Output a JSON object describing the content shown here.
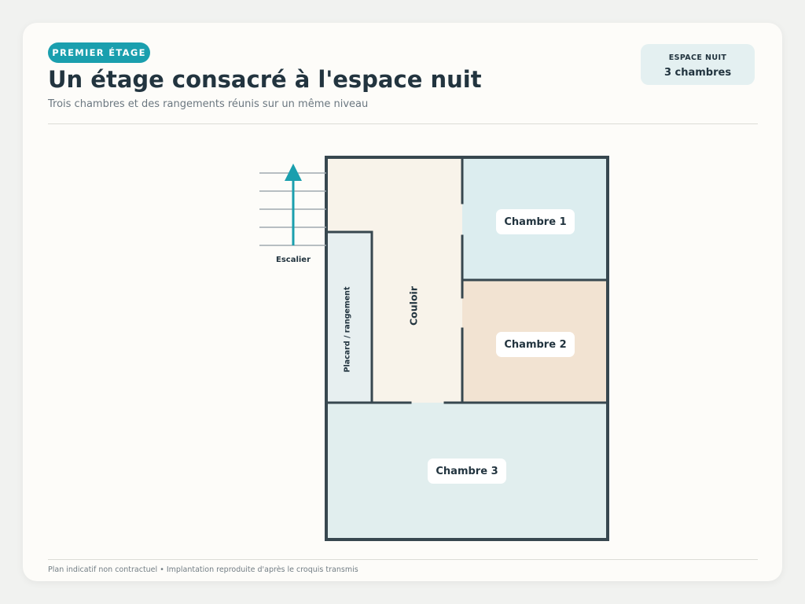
{
  "header": {
    "badge": "PREMIER ÉTAGE",
    "title": "Un étage consacré à l'espace nuit",
    "subtitle": "Trois chambres et des rangements réunis sur un même niveau"
  },
  "stat_card": {
    "label": "ESPACE NUIT",
    "value": "3 chambres"
  },
  "plan": {
    "rooms": {
      "chambre1": "Chambre 1",
      "chambre2": "Chambre 2",
      "chambre3": "Chambre 3",
      "couloir": "Couloir",
      "placard": "Placard / rangement"
    },
    "stairs_label": "Escalier",
    "colors": {
      "wall": "#37474f",
      "couloir_fill": "#f8f3ea",
      "placard_fill": "#e7eff0",
      "chambre1_fill": "#dcedef",
      "chambre2_fill": "#f2e3d2",
      "chambre3_fill": "#e1eeee",
      "stairs_arrow": "#1a9fae",
      "stairs_lines": "#a0aab0"
    }
  },
  "footer": "Plan indicatif non contractuel • Implantation reproduite d'après le croquis transmis"
}
